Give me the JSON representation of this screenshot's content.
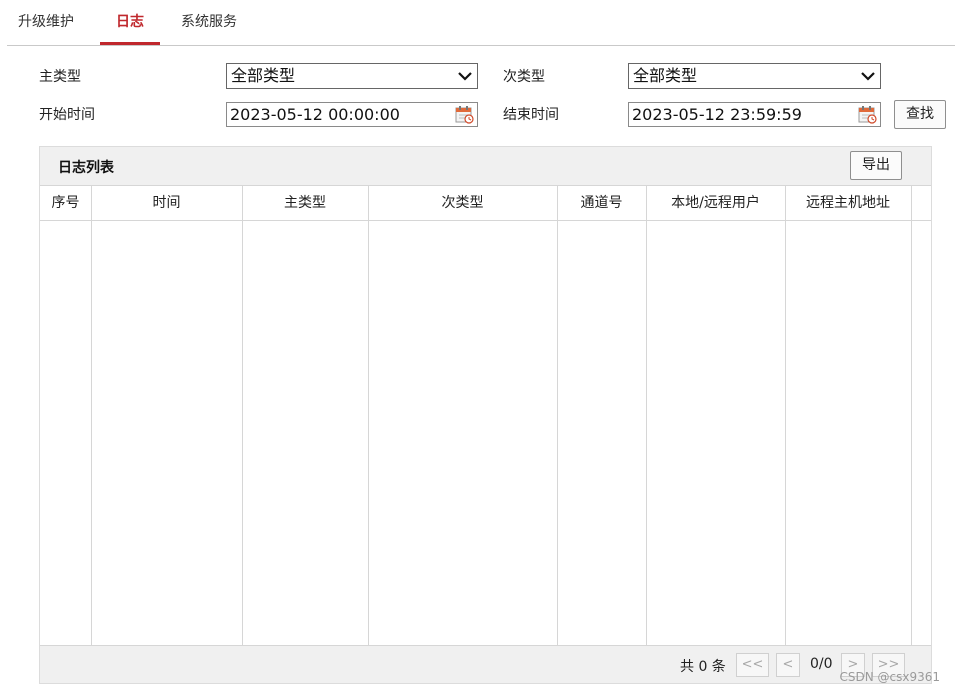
{
  "tabs": [
    {
      "label": "升级维护",
      "active": false
    },
    {
      "label": "日志",
      "active": true
    },
    {
      "label": "系统服务",
      "active": false
    }
  ],
  "filters": {
    "main_type_label": "主类型",
    "main_type_value": "全部类型",
    "sub_type_label": "次类型",
    "sub_type_value": "全部类型",
    "start_time_label": "开始时间",
    "start_time_value": "2023-05-12 00:00:00",
    "end_time_label": "结束时间",
    "end_time_value": "2023-05-12 23:59:59",
    "search_label": "查找"
  },
  "log_list": {
    "title": "日志列表",
    "export_label": "导出",
    "columns": [
      "序号",
      "时间",
      "主类型",
      "次类型",
      "通道号",
      "本地/远程用户",
      "远程主机地址"
    ],
    "rows": []
  },
  "pagination": {
    "total_text": "共 0 条",
    "first_label": "<<",
    "prev_label": "<",
    "page_text": "0/0",
    "next_label": ">",
    "last_label": ">>"
  },
  "watermark": "CSDN @csx9361",
  "colors": {
    "accent": "#c0282d",
    "panel_bg": "#f0f0f0",
    "border": "#d6d6d6"
  }
}
